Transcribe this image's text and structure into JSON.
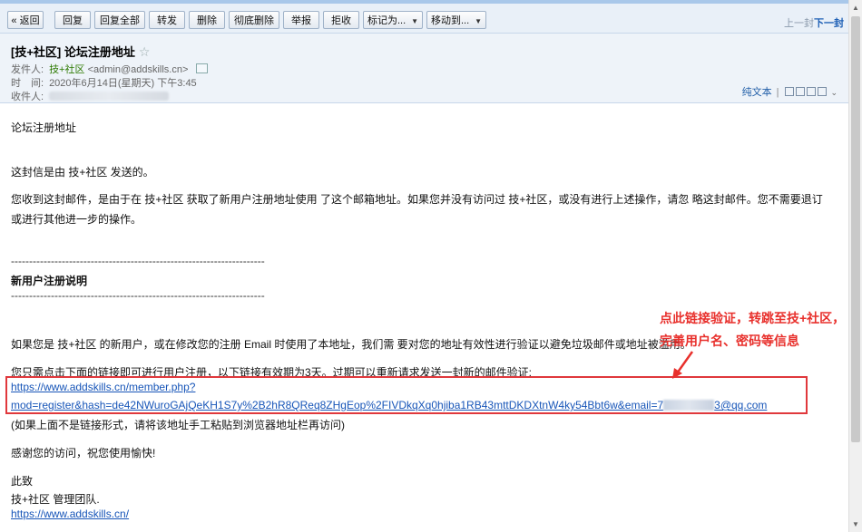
{
  "toolbar": {
    "back": "« 返回",
    "reply": "回复",
    "reply_all": "回复全部",
    "forward": "转发",
    "delete": "删除",
    "delete_permanent": "彻底删除",
    "report": "举报",
    "reject": "拒收",
    "mark_as": "标记为...",
    "move_to": "移动到...",
    "prev": "上一封",
    "next": "下一封"
  },
  "header": {
    "subject": "[技+社区] 论坛注册地址",
    "sender_label": "发件人:",
    "sender_name": "技+社区",
    "sender_email": "<admin@addskills.cn>",
    "time_label": "时　间:",
    "time_value": "2020年6月14日(星期天) 下午3:45",
    "recipient_label": "收件人:",
    "plain_text": "纯文本"
  },
  "body": {
    "title_line": "论坛注册地址",
    "sent_by": "这封信是由 技+社区 发送的。",
    "intro": "您收到这封邮件，是由于在 技+社区 获取了新用户注册地址使用 了这个邮箱地址。如果您并没有访问过 技+社区，或没有进行上述操作，请忽 略这封邮件。您不需要退订或进行其他进一步的操作。",
    "divider": "----------------------------------------------------------------------",
    "section_title": "新用户注册说明",
    "explanation": "如果您是 技+社区 的新用户，或在修改您的注册 Email 时使用了本地址，我们需 要对您的地址有效性进行验证以避免垃圾邮件或地址被滥用。",
    "instruction": "您只需点击下面的链接即可进行用户注册，以下链接有效期为3天。过期可以重新请求发送一封新的邮件验证:",
    "link_line1": "https://www.addskills.cn/member.php?",
    "link_line2_a": "mod=register&hash=de42NWuroGAjQeKH1S7y%2B2hR8QReq8ZHgEop%2FIVDkqXq0hjiba1RB43mttDKDXtnW4ky54Bbt6w&email=7",
    "link_line2_b": "3@qq.com",
    "fallback_note": "(如果上面不是链接形式，请将该地址手工粘贴到浏览器地址栏再访问)",
    "thanks": "感谢您的访问，祝您使用愉快!",
    "closing": "此致",
    "team": "技+社区 管理团队.",
    "site_link": "https://www.addskills.cn/"
  },
  "annotation": {
    "line1": "点此链接验证，转跳至技+社区，",
    "line2": "完善用户名、密码等信息",
    "color": "#e8302c"
  }
}
